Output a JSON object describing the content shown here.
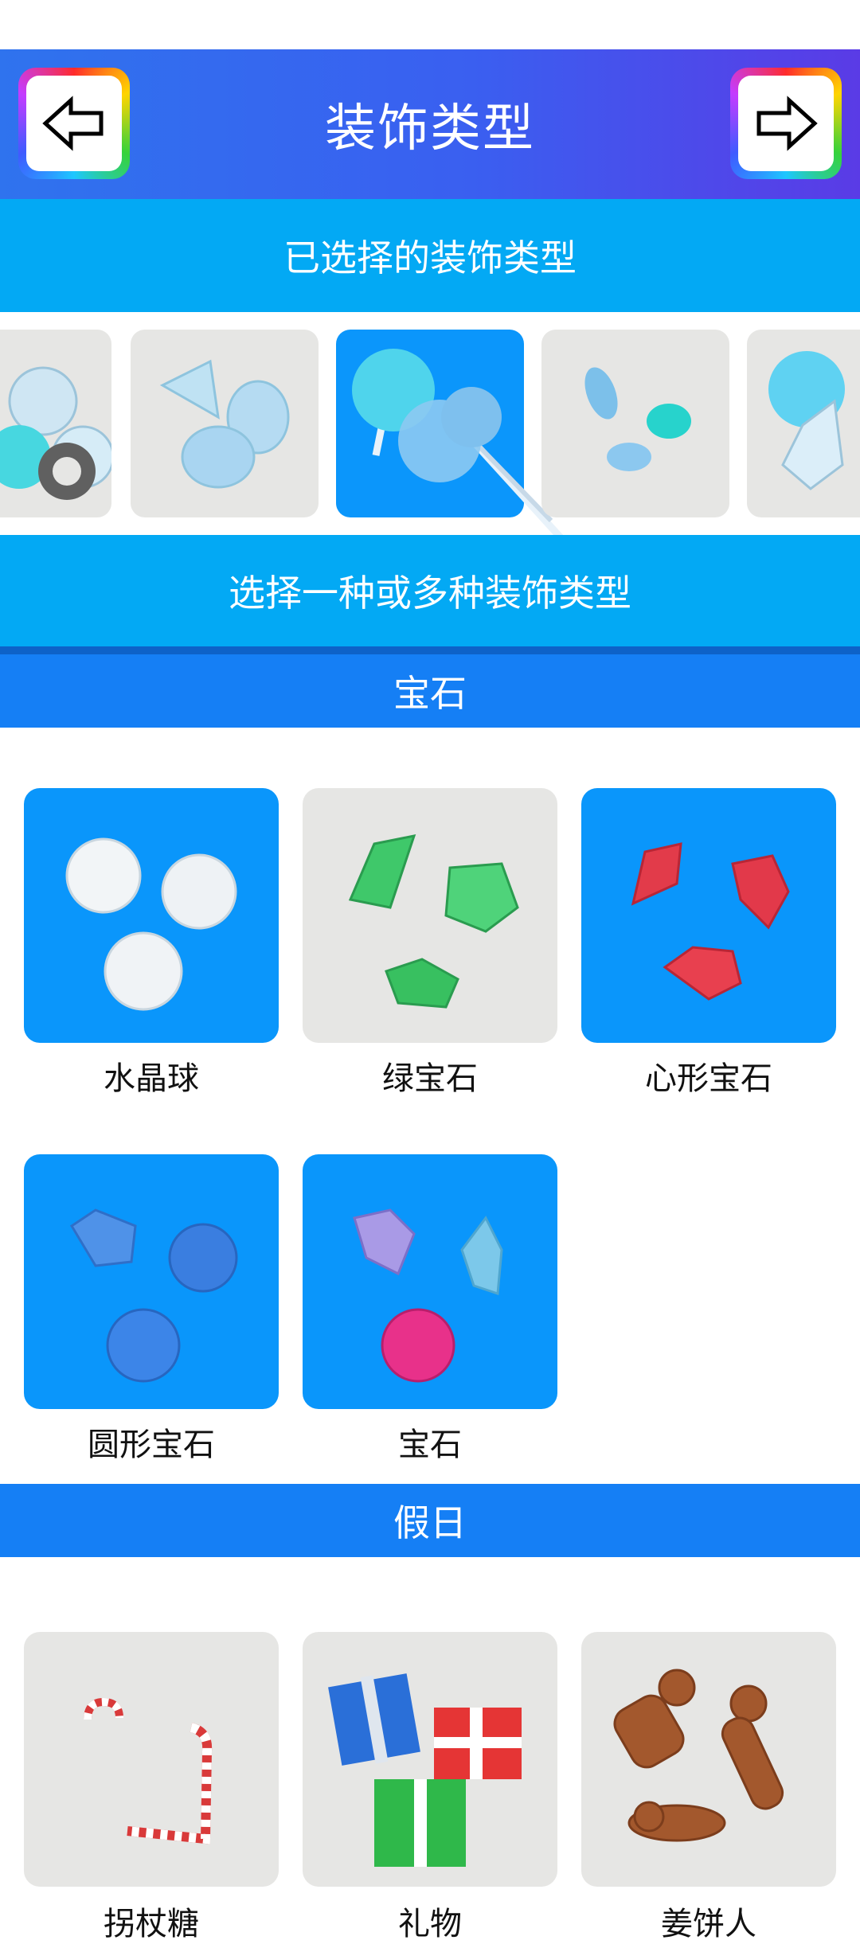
{
  "header": {
    "title": "装饰类型",
    "back_icon": "arrow-left-icon",
    "next_icon": "arrow-right-icon"
  },
  "selected_band": "已选择的装饰类型",
  "choose_band": "选择一种或多种装饰类型",
  "strip_items": [
    {
      "name": "crystal-cluster",
      "selected": false
    },
    {
      "name": "diamonds",
      "selected": false
    },
    {
      "name": "pins",
      "selected": true
    },
    {
      "name": "beads",
      "selected": false
    },
    {
      "name": "crystal-mix",
      "selected": false
    }
  ],
  "sections": [
    {
      "title": "宝石",
      "items": [
        {
          "label": "水晶球",
          "selected": true
        },
        {
          "label": "绿宝石",
          "selected": false
        },
        {
          "label": "心形宝石",
          "selected": true
        },
        {
          "label": "圆形宝石",
          "selected": true
        },
        {
          "label": "宝石",
          "selected": true
        }
      ]
    },
    {
      "title": "假日",
      "items": [
        {
          "label": "拐杖糖",
          "selected": false
        },
        {
          "label": "礼物",
          "selected": false
        },
        {
          "label": "姜饼人",
          "selected": false
        }
      ]
    }
  ],
  "colors": {
    "header_start": "#2f73ee",
    "header_end": "#5a3be6",
    "band": "#03a9f4",
    "section": "#157ff5",
    "selected_card": "#0a96fb",
    "unselected_card": "#e6e6e4"
  }
}
